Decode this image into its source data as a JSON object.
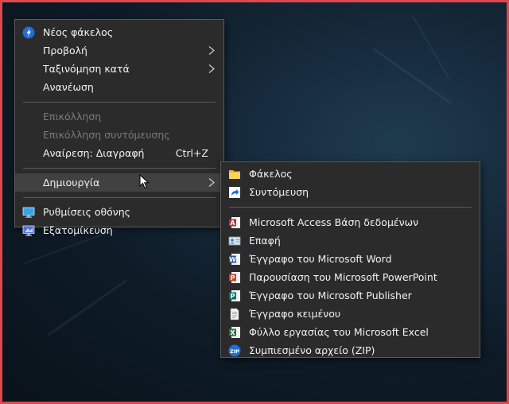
{
  "context_menu": {
    "items": [
      {
        "label": "Νέος φάκελος",
        "icon": "new-folder-icon"
      },
      {
        "label": "Προβολή",
        "submenu": true
      },
      {
        "label": "Ταξινόμηση κατά",
        "submenu": true
      },
      {
        "label": "Ανανέωση"
      },
      {
        "label": "Επικόλληση",
        "disabled": true
      },
      {
        "label": "Επικόλληση συντόμευσης",
        "disabled": true
      },
      {
        "label": "Αναίρεση: Διαγραφή",
        "shortcut": "Ctrl+Z"
      },
      {
        "label": "Δημιουργία",
        "submenu": true,
        "active": true
      },
      {
        "label": "Ρυθμίσεις οθόνης",
        "icon": "display-icon"
      },
      {
        "label": "Εξατομίκευση",
        "icon": "personalize-icon"
      }
    ]
  },
  "new_submenu": {
    "items": [
      {
        "label": "Φάκελος",
        "icon": "folder-icon"
      },
      {
        "label": "Συντόμευση",
        "icon": "shortcut-icon"
      },
      {
        "label": "Microsoft Access Βάση δεδομένων",
        "icon": "access-icon"
      },
      {
        "label": "Επαφή",
        "icon": "contact-icon"
      },
      {
        "label": "Έγγραφο του Microsoft Word",
        "icon": "word-icon"
      },
      {
        "label": "Παρουσίαση του Microsoft PowerPoint",
        "icon": "powerpoint-icon"
      },
      {
        "label": "Έγγραφο του Microsoft Publisher",
        "icon": "publisher-icon"
      },
      {
        "label": "Έγγραφο κειμένου",
        "icon": "text-document-icon"
      },
      {
        "label": "Φύλλο εργασίας του Microsoft Excel",
        "icon": "excel-icon"
      },
      {
        "label": "Συμπιεσμένο αρχείο (ZIP)",
        "icon": "zip-icon"
      }
    ]
  },
  "colors": {
    "menu_bg": "#2b2b2b",
    "menu_border": "#5a5a5a",
    "disabled_text": "#7a7a7a",
    "frame": "#e0474c"
  }
}
